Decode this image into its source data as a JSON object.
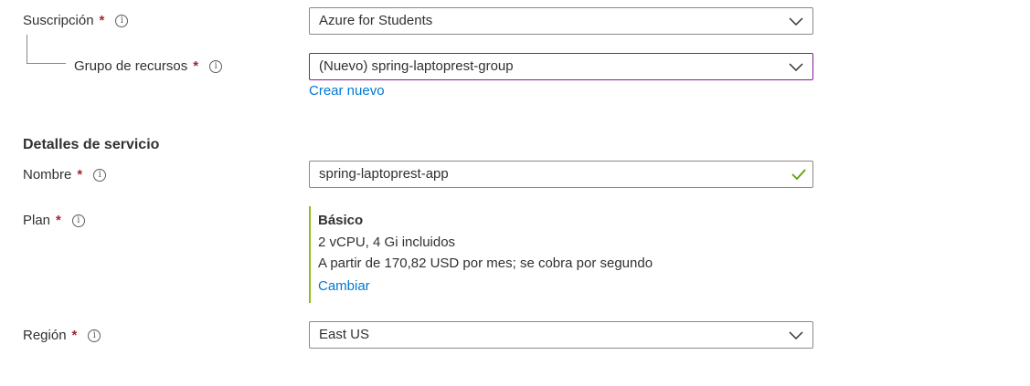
{
  "subscription": {
    "label": "Suscripción",
    "required": "*",
    "info": "i",
    "value": "Azure for Students"
  },
  "resource_group": {
    "label": "Grupo de recursos",
    "required": "*",
    "info": "i",
    "value": "(Nuevo) spring-laptoprest-group",
    "create_new": "Crear nuevo"
  },
  "service_details": {
    "title": "Detalles de servicio"
  },
  "name": {
    "label": "Nombre",
    "required": "*",
    "info": "i",
    "value": "spring-laptoprest-app"
  },
  "plan": {
    "label": "Plan",
    "required": "*",
    "info": "i",
    "tier": "Básico",
    "resources": "2 vCPU, 4 Gi incluidos",
    "price": "A partir de 170,82 USD por mes; se cobra por segundo",
    "change": "Cambiar"
  },
  "region": {
    "label": "Región",
    "required": "*",
    "info": "i",
    "value": "East US"
  },
  "colors": {
    "required": "#a4262c",
    "link": "#0078d4",
    "focus_border": "#881798",
    "valid_check": "#57a300",
    "plan_accent": "#8cbd18"
  }
}
